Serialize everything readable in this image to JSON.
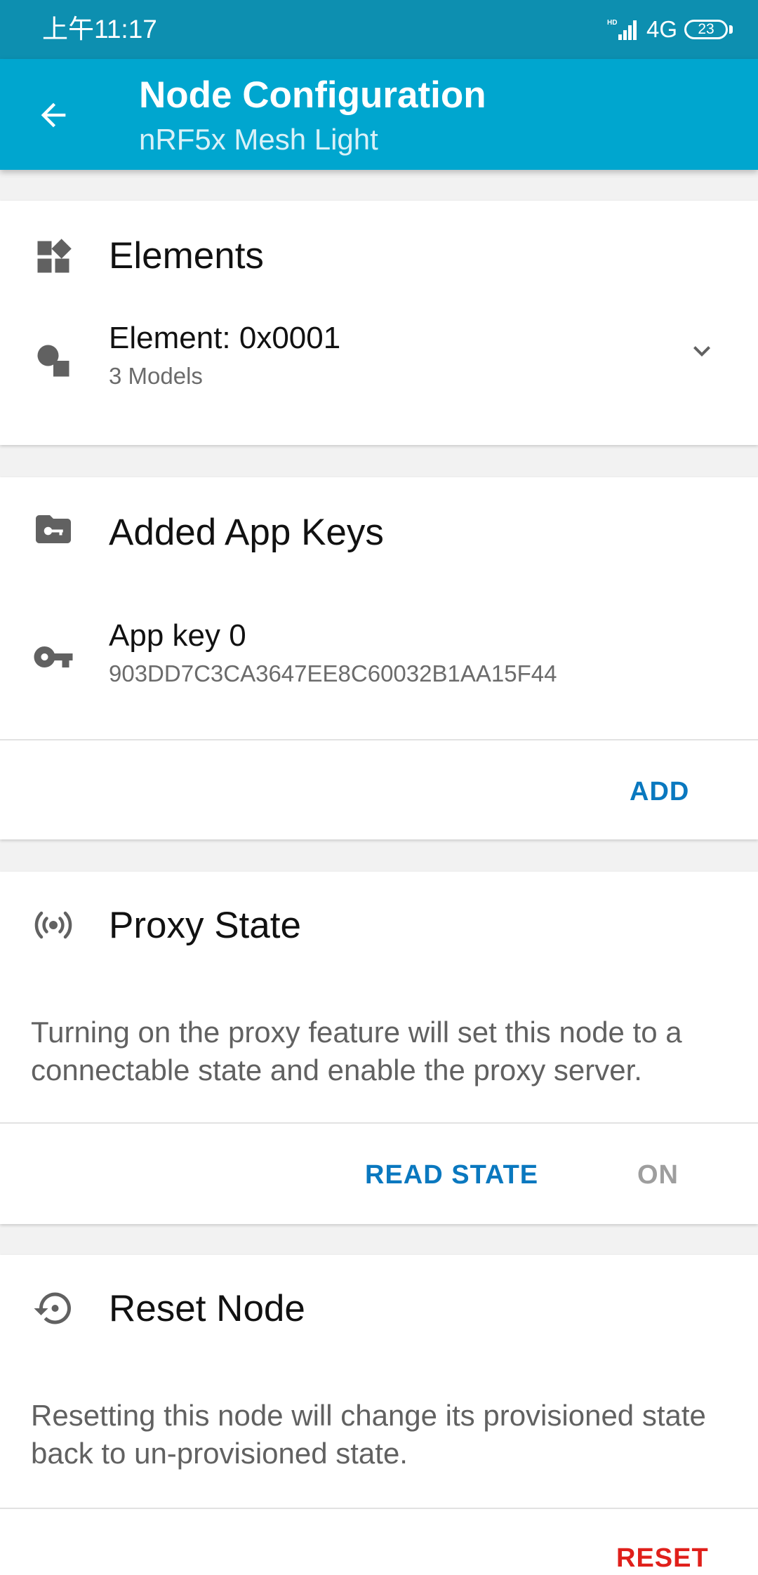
{
  "status_bar": {
    "time": "上午11:17",
    "network": "4G",
    "battery": "23"
  },
  "app_bar": {
    "title": "Node Configuration",
    "subtitle": "nRF5x Mesh Light"
  },
  "elements_card": {
    "title": "Elements",
    "element": {
      "title": "Element: 0x0001",
      "subtitle": "3 Models"
    }
  },
  "app_keys_card": {
    "title": "Added App Keys",
    "key": {
      "title": "App key 0",
      "value": "903DD7C3CA3647EE8C60032B1AA15F44"
    },
    "add_label": "ADD"
  },
  "proxy_card": {
    "title": "Proxy State",
    "description": "Turning on the proxy feature will set this node to a connectable state and enable the proxy server.",
    "read_state_label": "READ STATE",
    "toggle_label": "ON"
  },
  "reset_card": {
    "title": "Reset Node",
    "description": "Resetting this node will change its provisioned state back to un-provisioned state.",
    "reset_label": "RESET"
  },
  "colors": {
    "primary": "#00a6cf",
    "status_bar": "#0d8fb0",
    "accent_blue": "#0a78bf",
    "disabled": "#9e9e9e",
    "danger": "#e0201b"
  }
}
